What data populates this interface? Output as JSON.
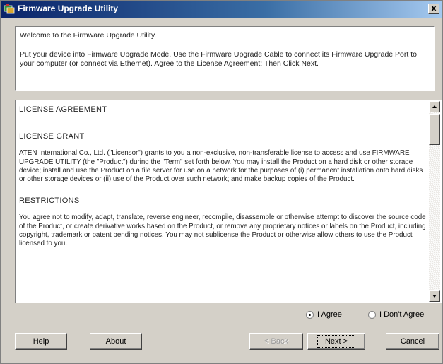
{
  "window": {
    "title": "Firmware Upgrade Utility",
    "close_glyph": "X",
    "icon": "app-icon"
  },
  "intro": {
    "welcome": "Welcome to the Firmware Upgrade Utility.",
    "instructions": "Put your device into Firmware Upgrade Mode. Use the Firmware Upgrade Cable to connect its Firmware Upgrade Port to your computer (or connect via Ethernet). Agree to the License Agreement; Then Click Next."
  },
  "license": {
    "title": "LICENSE AGREEMENT",
    "grant_heading": "LICENSE GRANT",
    "grant_text": "ATEN International Co., Ltd. (\"Licensor\") grants to you a non-exclusive, non-transferable license to access and use FIRMWARE UPGRADE UTILITY (the \"Product\") during the \"Term\" set forth below. You may install the Product on a hard disk or other storage device; install and use the Product on a file server for use on a network for the purposes of (i) permanent installation onto hard disks or other storage devices or (ii) use of the Product over such network; and make backup copies of the Product.",
    "restrictions_heading": "RESTRICTIONS",
    "restrictions_text": "You agree not to modify, adapt, translate, reverse engineer, recompile, disassemble or otherwise attempt to discover the source code of the Product, or create derivative works based on the Product, or remove any proprietary notices or labels on the Product, including copyright, trademark or patent pending notices. You may not sublicense the Product or otherwise allow others to use the Product licensed to you.",
    "scroll_position": 0.0
  },
  "agreement": {
    "agree_label": "I Agree",
    "disagree_label": "I Don't Agree",
    "selected": "agree"
  },
  "buttons": {
    "help": "Help",
    "about": "About",
    "back": "< Back",
    "next": "Next >",
    "cancel": "Cancel"
  }
}
